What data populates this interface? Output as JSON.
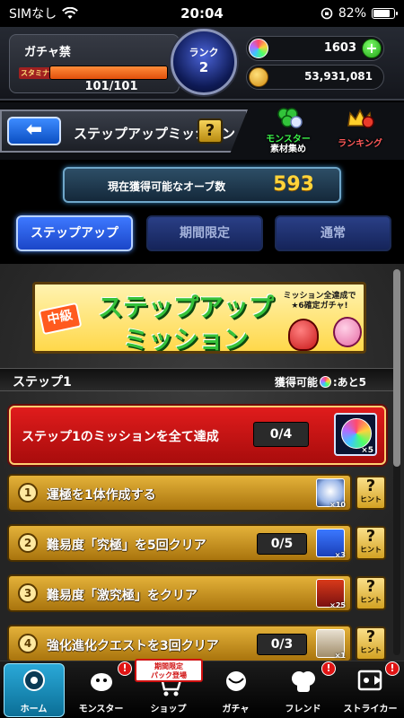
{
  "status_bar": {
    "carrier": "SIMなし",
    "time": "20:04",
    "battery": "82%",
    "battery_level": 0.82
  },
  "player": {
    "name": "ガチャ禁",
    "stamina_label": "スタミナ",
    "stamina_text": "101/101",
    "stamina_level": 1.0,
    "rank_label": "ランク",
    "rank_value": "2",
    "orbs": "1603",
    "coins": "53,931,081"
  },
  "title_bar": {
    "back_icon": "arrow-left-icon",
    "title": "ステップアップミッション",
    "help_label": "?",
    "monster_link": [
      "モンスター",
      "素材集め"
    ],
    "ranking_link": "ランキング"
  },
  "orb_counter": {
    "label": "現在獲得可能なオーブ数",
    "value": "593"
  },
  "tabs": [
    {
      "label": "ステップアップ",
      "active": true
    },
    {
      "label": "期間限定",
      "active": false
    },
    {
      "label": "通常",
      "active": false
    }
  ],
  "banner": {
    "badge": "中級",
    "title_line1": "ステップアップ",
    "title_line2": "ミッション",
    "subtitle": "ミッション全達成で★6確定ガチャ!"
  },
  "step": {
    "title": "ステップ1",
    "available_prefix": "獲得可能",
    "available_suffix": ":あと5"
  },
  "main_mission": {
    "label": "ステップ1のミッションを全て達成",
    "progress": "0/4",
    "reward_count": "×5"
  },
  "missions": [
    {
      "num": "1",
      "label": "運極を1体作成する",
      "progress": "",
      "reward_count": "×10",
      "reward_color": "#1a3a7a",
      "hint": "ヒント"
    },
    {
      "num": "2",
      "label": "難易度「究極」を5回クリア",
      "progress": "0/5",
      "reward_count": "×3",
      "reward_color": "#1a4fd6",
      "hint": "ヒント"
    },
    {
      "num": "3",
      "label": "難易度「激究極」をクリア",
      "progress": "",
      "reward_count": "×25",
      "reward_color": "#b21a1a",
      "hint": "ヒント"
    },
    {
      "num": "4",
      "label": "強化進化クエストを3回クリア",
      "progress": "0/3",
      "reward_count": "×1",
      "reward_color": "#1a3a7a",
      "hint": "ヒント"
    }
  ],
  "bottom_nav": {
    "items": [
      {
        "label": "ホーム",
        "icon": "home-icon",
        "active": true,
        "badge": ""
      },
      {
        "label": "モンスター",
        "icon": "monster-icon",
        "active": false,
        "badge": "!"
      },
      {
        "label": "ショップ",
        "icon": "shop-cart-icon",
        "active": false,
        "badge": "!"
      },
      {
        "label": "ガチャ",
        "icon": "gacha-icon",
        "active": false,
        "badge": ""
      },
      {
        "label": "フレンド",
        "icon": "friend-icon",
        "active": false,
        "badge": "!"
      },
      {
        "label": "ストライカー",
        "icon": "striker-icon",
        "active": false,
        "badge": "!"
      }
    ],
    "limited_tag": [
      "期間限定",
      "パック登場"
    ]
  }
}
